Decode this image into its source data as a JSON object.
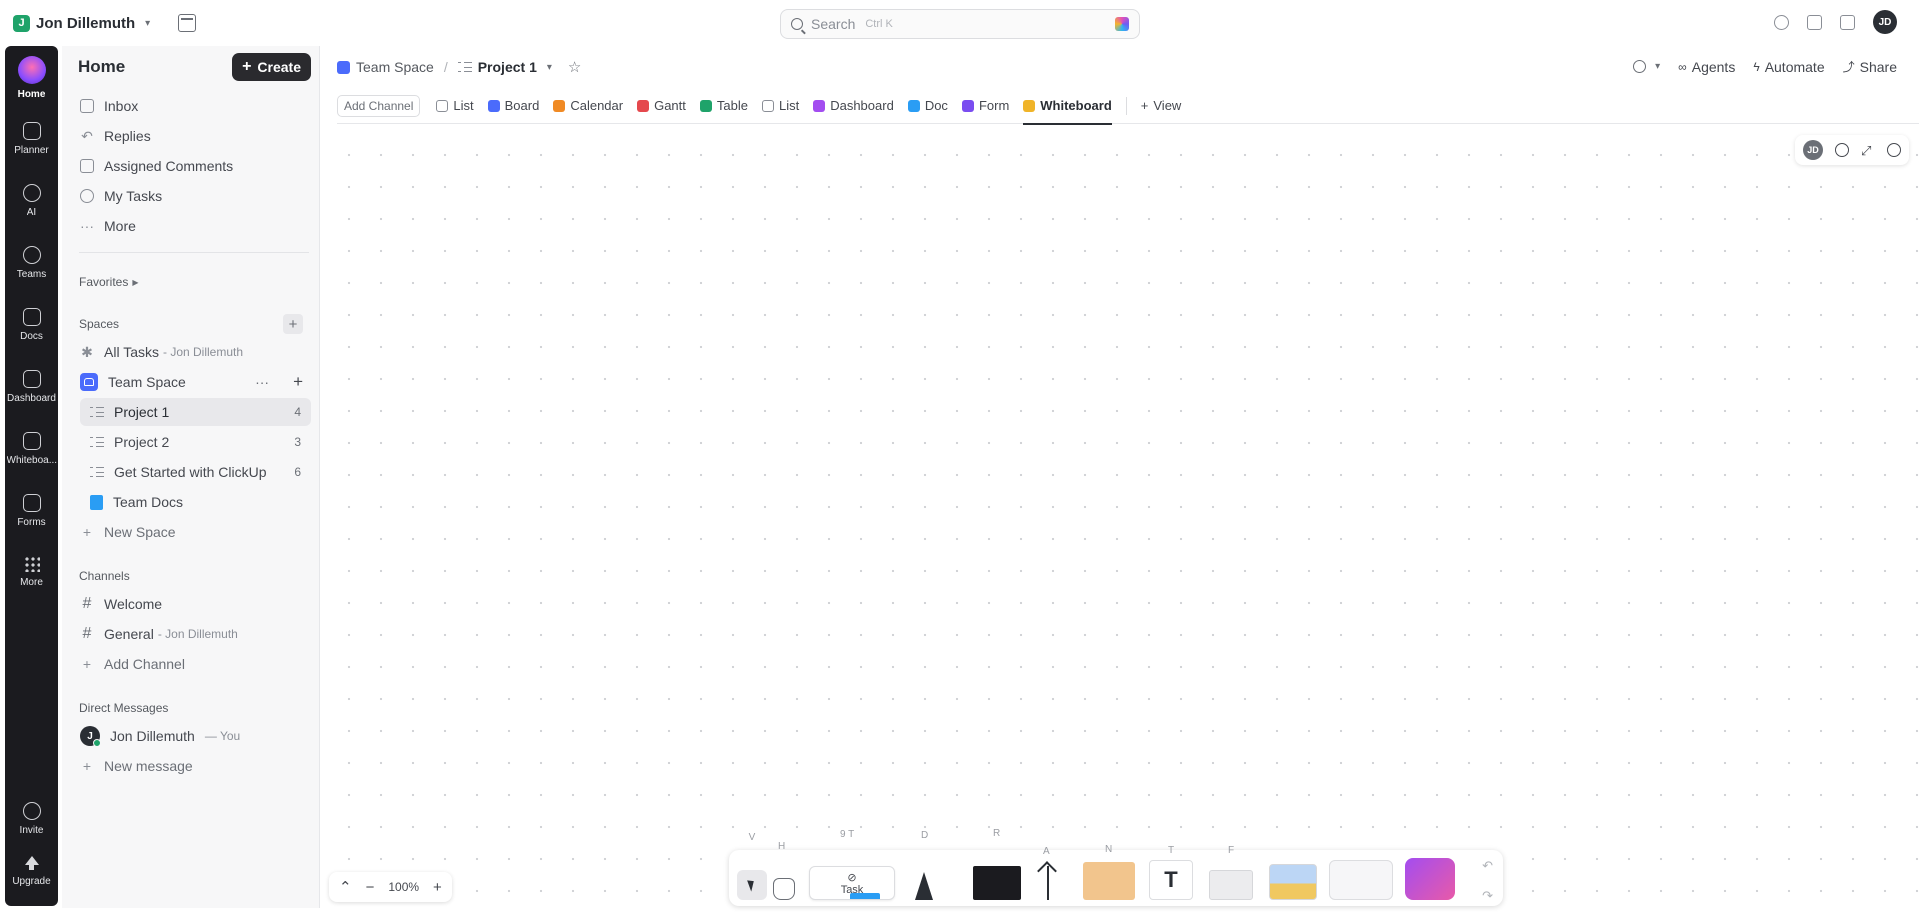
{
  "topbar": {
    "workspace_initial": "J",
    "workspace_name": "Jon Dillemuth",
    "search_placeholder": "Search",
    "search_shortcut": "Ctrl K",
    "user_initials": "JD"
  },
  "rail": {
    "items": [
      {
        "label": "Home",
        "icon": "home-icon"
      },
      {
        "label": "Planner",
        "icon": "calendar-icon"
      },
      {
        "label": "AI",
        "icon": "ai-icon"
      },
      {
        "label": "Teams",
        "icon": "teams-icon"
      },
      {
        "label": "Docs",
        "icon": "docs-icon"
      },
      {
        "label": "Dashboard",
        "icon": "dashboard-icon"
      },
      {
        "label": "Whiteboa...",
        "icon": "whiteboard-icon"
      },
      {
        "label": "Forms",
        "icon": "forms-icon"
      },
      {
        "label": "More",
        "icon": "grid-icon"
      },
      {
        "label": "Invite",
        "icon": "invite-icon"
      },
      {
        "label": "Upgrade",
        "icon": "upgrade-icon"
      }
    ]
  },
  "sidebar": {
    "title": "Home",
    "create_label": "Create",
    "nav": [
      {
        "label": "Inbox"
      },
      {
        "label": "Replies"
      },
      {
        "label": "Assigned Comments"
      },
      {
        "label": "My Tasks"
      },
      {
        "label": "More"
      }
    ],
    "favorites_label": "Favorites",
    "spaces_label": "Spaces",
    "all_tasks_label": "All Tasks",
    "all_tasks_owner": "- Jon Dillemuth",
    "space_name": "Team Space",
    "lists": [
      {
        "label": "Project 1",
        "count": "4"
      },
      {
        "label": "Project 2",
        "count": "3"
      },
      {
        "label": "Get Started with ClickUp",
        "count": "6"
      }
    ],
    "team_docs_label": "Team Docs",
    "new_space_label": "New Space",
    "channels_label": "Channels",
    "channels": [
      {
        "label": "Welcome",
        "sub": ""
      },
      {
        "label": "General",
        "sub": "- Jon Dillemuth"
      }
    ],
    "add_channel_label": "Add Channel",
    "dm_label": "Direct Messages",
    "dm_user_initial": "J",
    "dm_user": "Jon Dillemuth",
    "dm_you": "— You",
    "new_message_label": "New message"
  },
  "header": {
    "space": "Team Space",
    "separator": "/",
    "project": "Project 1",
    "agents_label": "Agents",
    "automate_label": "Automate",
    "share_label": "Share"
  },
  "tabs": {
    "add_channel": "Add Channel",
    "items": [
      {
        "label": "List",
        "color": "#8a8e96"
      },
      {
        "label": "Board",
        "color": "#4b6bfb"
      },
      {
        "label": "Calendar",
        "color": "#f08a24"
      },
      {
        "label": "Gantt",
        "color": "#e5484d"
      },
      {
        "label": "Table",
        "color": "#1fa36a"
      },
      {
        "label": "List",
        "color": "#8a8e96"
      },
      {
        "label": "Dashboard",
        "color": "#a34df0"
      },
      {
        "label": "Doc",
        "color": "#2a9df4"
      },
      {
        "label": "Form",
        "color": "#7a4df0"
      },
      {
        "label": "Whiteboard",
        "color": "#f0b429"
      }
    ],
    "view_label": "View"
  },
  "canvas": {
    "collaborator_initials": "JD",
    "zoom_level": "100%",
    "toolbar": {
      "task_label": "Task",
      "text_glyph": "T",
      "keys": {
        "select": "V",
        "hand": "H",
        "task": "9 T",
        "pen": "D",
        "rectangle": "R",
        "arrow": "A",
        "note": "N",
        "text": "T",
        "frame": "F"
      }
    }
  }
}
